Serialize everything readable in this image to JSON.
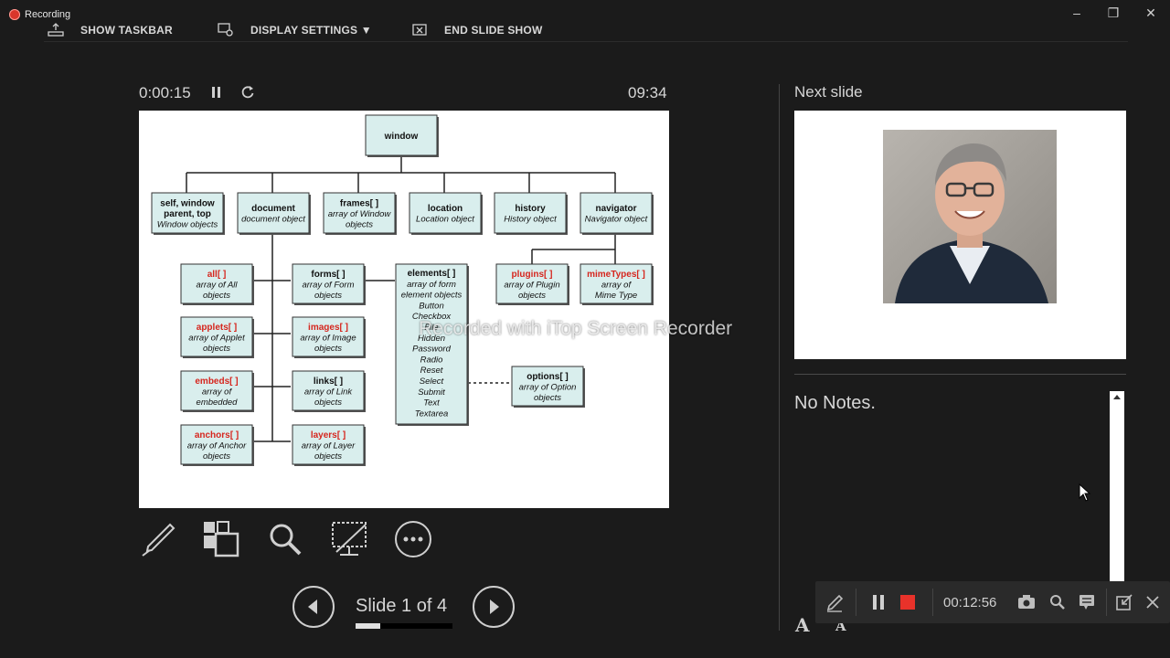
{
  "recording_badge": "Recording",
  "toolbar": {
    "show_taskbar": "SHOW TASKBAR",
    "display_settings": "DISPLAY SETTINGS ▼",
    "end_slide_show": "END SLIDE SHOW"
  },
  "presenter": {
    "elapsed": "0:00:15",
    "clock": "09:34",
    "next_slide_label": "Next slide",
    "notes": "No Notes.",
    "slide_counter": "Slide 1 of 4",
    "progress_fraction": 0.25
  },
  "recorder": {
    "time": "00:12:56",
    "watermark": "Recorded with iTop Screen Recorder"
  },
  "diagram": {
    "root": "window",
    "row1": [
      {
        "title": "self, window\nparent, top",
        "sub": "Window objects"
      },
      {
        "title": "document",
        "sub": "document object"
      },
      {
        "title": "frames[ ]",
        "sub": "array of Window\nobjects"
      },
      {
        "title": "location",
        "sub": "Location object"
      },
      {
        "title": "history",
        "sub": "History object"
      },
      {
        "title": "navigator",
        "sub": "Navigator object"
      }
    ],
    "left_col": [
      {
        "title": "all[ ]",
        "sub": "array of All\nobjects"
      },
      {
        "title": "applets[ ]",
        "sub": "array of Applet\nobjects"
      },
      {
        "title": "embeds[ ]",
        "sub": "array of\nembedded"
      },
      {
        "title": "anchors[ ]",
        "sub": "array of Anchor\nobjects"
      }
    ],
    "mid_col": [
      {
        "title": "forms[ ]",
        "sub": "array of Form\nobjects"
      },
      {
        "title": "images[ ]",
        "sub": "array of Image\nobjects"
      },
      {
        "title": "links[ ]",
        "sub": "array of Link\nobjects"
      },
      {
        "title": "layers[ ]",
        "sub": "array of Layer\nobjects"
      }
    ],
    "elements": {
      "title": "elements[ ]",
      "lines": [
        "array of form",
        "element objects",
        "Button",
        "Checkbox",
        "File",
        "Hidden",
        "Password",
        "Radio",
        "Reset",
        "Select",
        "Submit",
        "Text",
        "Textarea"
      ]
    },
    "options": {
      "title": "options[ ]",
      "sub": "array of Option\nobjects"
    },
    "plugins": {
      "title": "plugins[ ]",
      "sub": "array of Plugin\nobjects"
    },
    "mimetypes": {
      "title": "mimeTypes[ ]",
      "sub": "array of\nMime Type"
    }
  },
  "colors": {
    "box_fill": "#d9eeed",
    "red_title": "#d6261e",
    "record_red": "#e8322a"
  }
}
